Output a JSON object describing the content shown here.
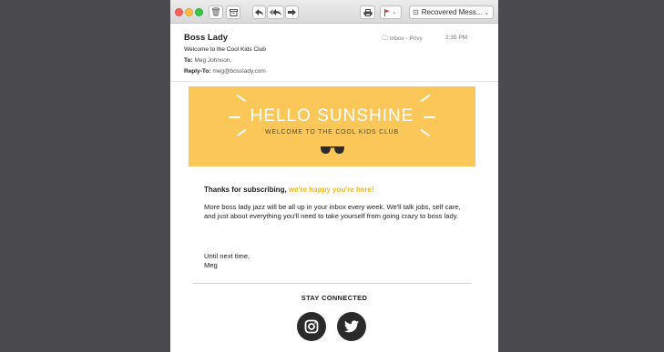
{
  "toolbar": {
    "mailbox_label": "Recovered Mess...",
    "icons": [
      "trash-icon",
      "archive-icon",
      "reply-icon",
      "reply-all-icon",
      "forward-icon",
      "print-icon",
      "flag-icon",
      "mailbox-icon"
    ]
  },
  "message": {
    "sender": "Boss Lady",
    "subject": "Welcome to the Cool Kids Club",
    "to_label": "To:",
    "to_value": "Meg Johnson,",
    "reply_to_label": "Reply-To:",
    "reply_to_value": "meg@bosslady.com",
    "mailbox_path": "Inbox - Privy",
    "time": "2:35 PM"
  },
  "banner": {
    "headline": "HELLO SUNSHINE",
    "subheadline": "WELCOME TO THE COOL KIDS CLUB"
  },
  "body": {
    "thanks_lead": "Thanks for subscribing, ",
    "thanks_accent": "we're happy you're here!",
    "paragraph": "More boss lady jazz will be all up in your inbox every week. We'll talk jobs, self care, and just about everything you'll need to take yourself from going crazy to boss lady.",
    "signoff_line1": "Until next time,",
    "signoff_line2": "Meg"
  },
  "footer": {
    "stay_connected": "STAY CONNECTED",
    "social": [
      "instagram-icon",
      "twitter-icon"
    ]
  },
  "colors": {
    "banner": "#fcc759",
    "accent": "#f6b519",
    "background": "#4a4a4f"
  }
}
